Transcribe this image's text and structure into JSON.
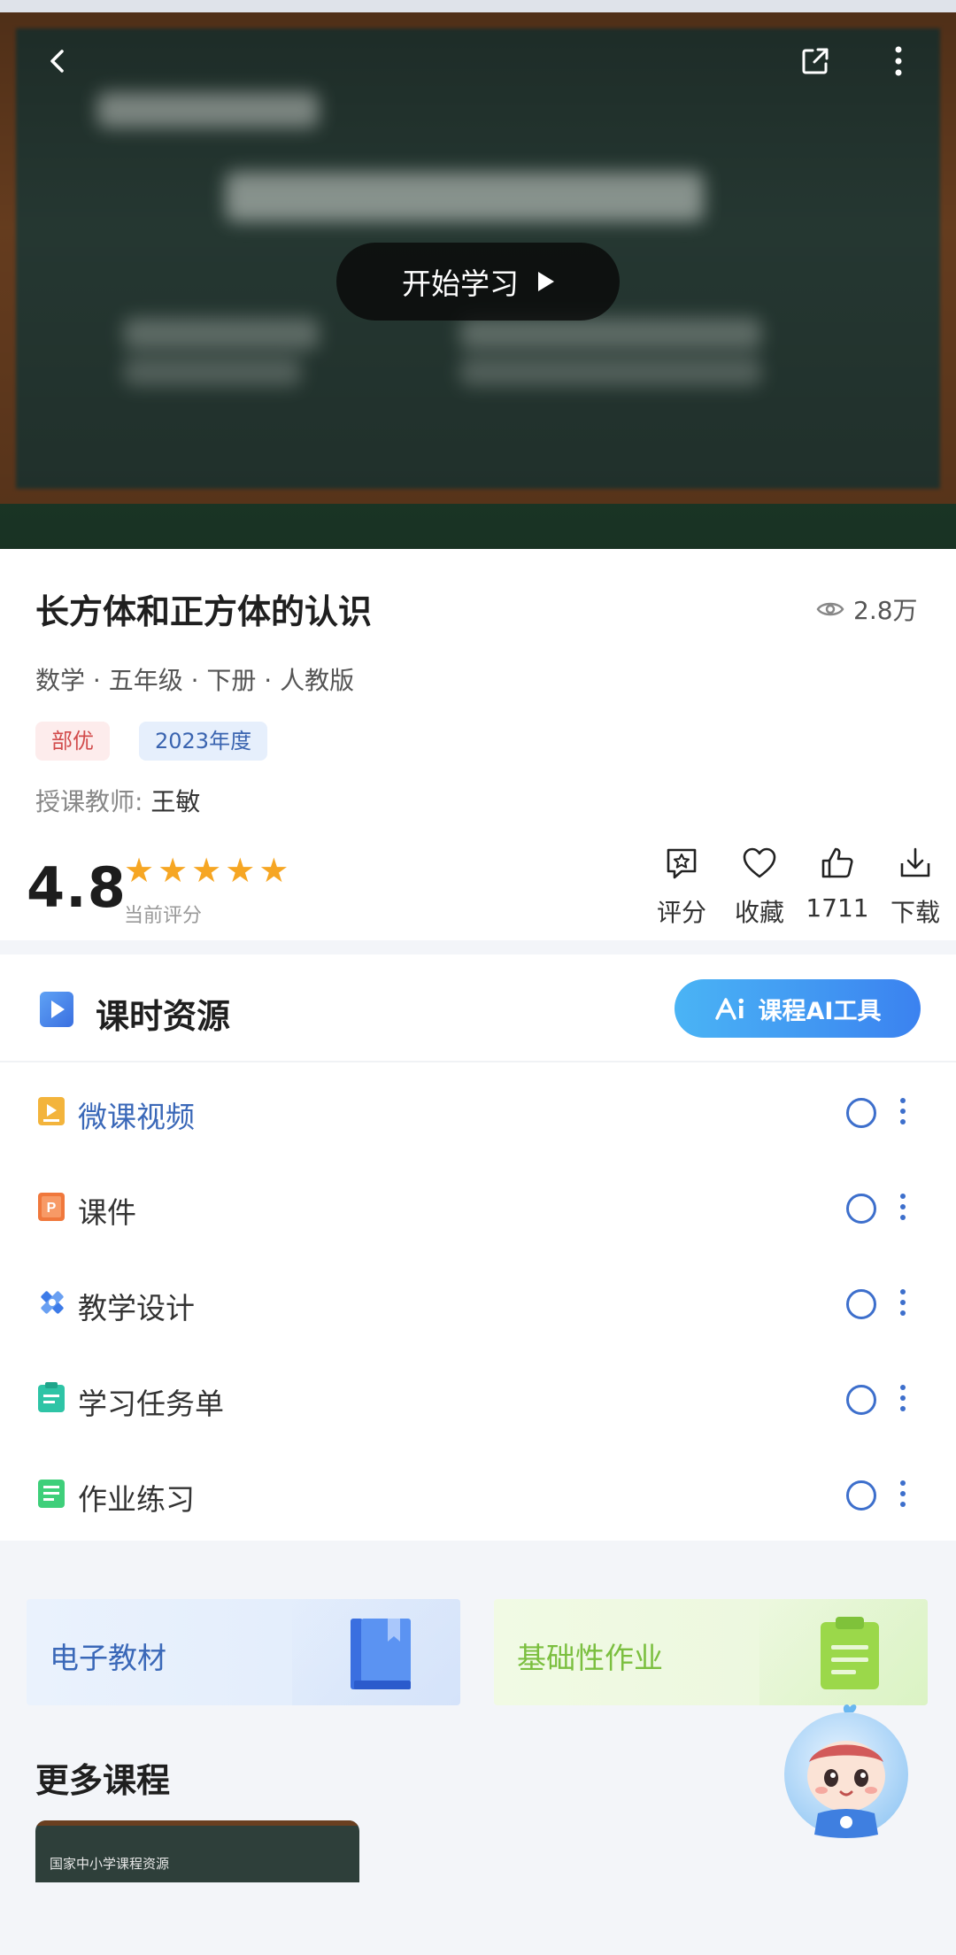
{
  "video": {
    "play_label": "开始学习"
  },
  "course": {
    "title": "长方体和正方体的认识",
    "views": "2.8万",
    "meta": "数学 · 五年级 · 下册 · 人教版",
    "tags": [
      "部优",
      "2023年度"
    ],
    "teacher_label": "授课教师:",
    "teacher_name": "王敏"
  },
  "rating": {
    "score": "4.8",
    "stars": 5,
    "label": "当前评分"
  },
  "actions": [
    {
      "label": "评分",
      "icon": "rate-icon"
    },
    {
      "label": "收藏",
      "icon": "heart-icon"
    },
    {
      "label": "1711",
      "icon": "thumbs-up-icon"
    },
    {
      "label": "下载",
      "icon": "download-icon"
    }
  ],
  "resources": {
    "title": "课时资源",
    "ai_button": "课程AI工具",
    "items": [
      {
        "label": "微课视频",
        "icon": "video-file-icon",
        "color": "#f3b43c",
        "active": true
      },
      {
        "label": "课件",
        "icon": "ppt-file-icon",
        "color": "#f0783c"
      },
      {
        "label": "教学设计",
        "icon": "design-tools-icon",
        "color": "#3d7be8"
      },
      {
        "label": "学习任务单",
        "icon": "task-list-icon",
        "color": "#2ec4a6"
      },
      {
        "label": "作业练习",
        "icon": "homework-icon",
        "color": "#3ecf7a"
      }
    ]
  },
  "cards": {
    "textbook": "电子教材",
    "homework": "基础性作业"
  },
  "more": {
    "title": "更多课程",
    "thumb_caption": "国家中小学课程资源"
  },
  "colors": {
    "accent_blue": "#3d6fcc",
    "star": "#f6a623",
    "tag_red": "#d24b4b",
    "card_green_text": "#7bbf3f"
  }
}
